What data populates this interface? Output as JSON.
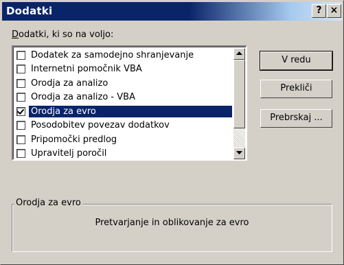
{
  "window": {
    "title": "Dodatki",
    "help_button": "?",
    "close_button": "×"
  },
  "list_label": {
    "prefix": "D",
    "rest": "odatki, ki so na voljo:"
  },
  "addins": [
    {
      "label": "Dodatek za samodejno shranjevanje",
      "checked": false,
      "selected": false
    },
    {
      "label": "Internetni pomočnik VBA",
      "checked": false,
      "selected": false
    },
    {
      "label": "Orodja za analizo",
      "checked": false,
      "selected": false
    },
    {
      "label": "Orodja za analizo - VBA",
      "checked": false,
      "selected": false
    },
    {
      "label": "Orodja za evro",
      "checked": true,
      "selected": true
    },
    {
      "label": "Posodobitev povezav dodatkov",
      "checked": false,
      "selected": false
    },
    {
      "label": "Pripomočki predlog",
      "checked": false,
      "selected": false
    },
    {
      "label": "Upravitelj poročil",
      "checked": false,
      "selected": false
    }
  ],
  "buttons": {
    "ok": "V redu",
    "cancel": "Prekliči",
    "browse": "Prebrskaj ..."
  },
  "description": {
    "title": "Orodja za evro",
    "text": "Pretvarjanje in oblikovanje za evro"
  }
}
